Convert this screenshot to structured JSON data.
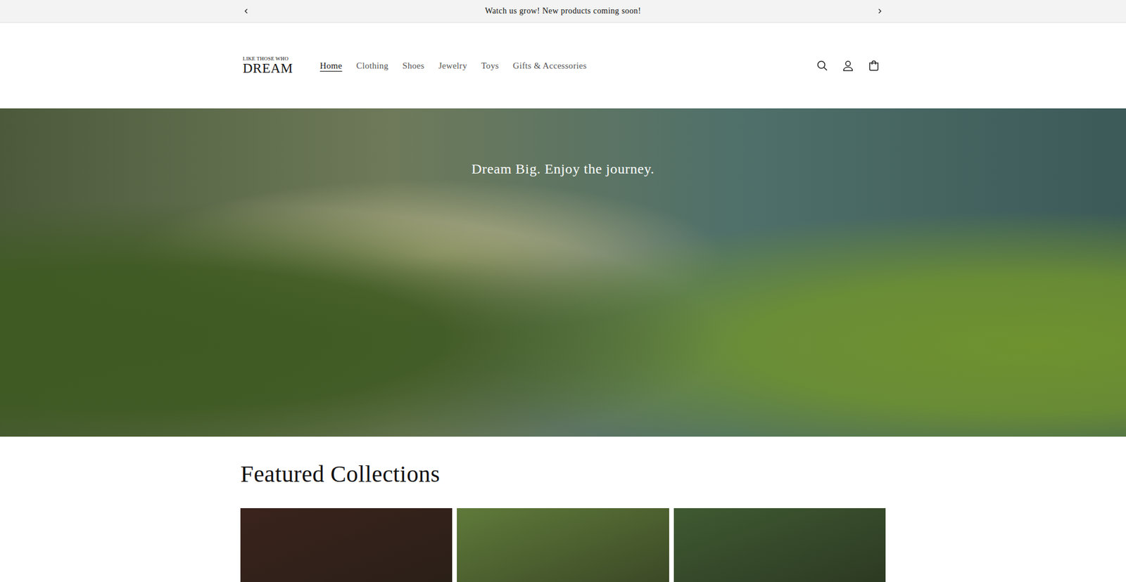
{
  "announcement": {
    "text": "Watch us grow! New products coming soon!"
  },
  "logo": {
    "top": "LIKE THOSE WHO",
    "main": "DREAM"
  },
  "nav": [
    {
      "label": "Home",
      "selected": true
    },
    {
      "label": "Clothing",
      "selected": false
    },
    {
      "label": "Shoes",
      "selected": false
    },
    {
      "label": "Jewelry",
      "selected": false
    },
    {
      "label": "Toys",
      "selected": false
    },
    {
      "label": "Gifts & Accessories",
      "selected": false
    }
  ],
  "hero": {
    "heading": "Dream Big. Enjoy the journey."
  },
  "featured": {
    "title": "Featured Collections",
    "collections": [
      {
        "color": "#3a231c"
      },
      {
        "color": "#5f7a3a"
      },
      {
        "color": "#3f5a32"
      }
    ]
  }
}
